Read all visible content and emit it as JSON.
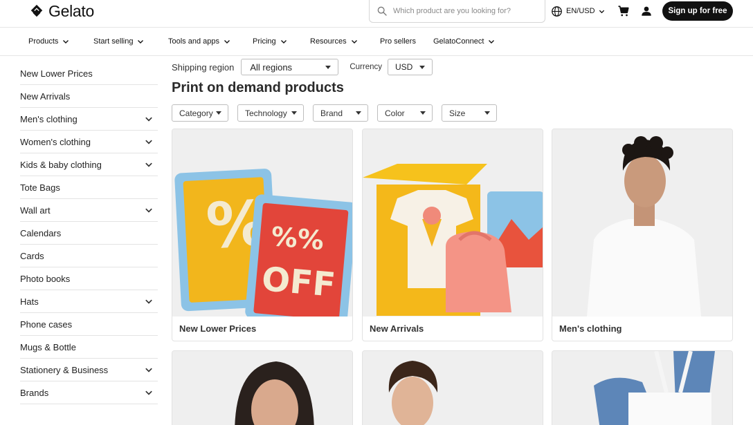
{
  "header": {
    "logo_text": "Gelato",
    "search_placeholder": "Which product are you looking for?",
    "lang_label": "EN/USD",
    "signup_label": "Sign up for free"
  },
  "nav": {
    "items": [
      {
        "label": "Products",
        "has_dropdown": true
      },
      {
        "label": "Start selling",
        "has_dropdown": true
      },
      {
        "label": "Tools and apps",
        "has_dropdown": true
      },
      {
        "label": "Pricing",
        "has_dropdown": true
      },
      {
        "label": "Resources",
        "has_dropdown": true
      },
      {
        "label": "Pro sellers",
        "has_dropdown": false
      },
      {
        "label": "GelatoConnect",
        "has_dropdown": true
      }
    ]
  },
  "sidebar": {
    "items": [
      {
        "label": "New Lower Prices",
        "expandable": false
      },
      {
        "label": "New Arrivals",
        "expandable": false
      },
      {
        "label": "Men's clothing",
        "expandable": true
      },
      {
        "label": "Women's clothing",
        "expandable": true
      },
      {
        "label": "Kids & baby clothing",
        "expandable": true
      },
      {
        "label": "Tote Bags",
        "expandable": false
      },
      {
        "label": "Wall art",
        "expandable": true
      },
      {
        "label": "Calendars",
        "expandable": false
      },
      {
        "label": "Cards",
        "expandable": false
      },
      {
        "label": "Photo books",
        "expandable": false
      },
      {
        "label": "Hats",
        "expandable": true
      },
      {
        "label": "Phone cases",
        "expandable": false
      },
      {
        "label": "Mugs & Bottle",
        "expandable": false
      },
      {
        "label": "Stationery & Business",
        "expandable": true
      },
      {
        "label": "Brands",
        "expandable": true
      }
    ]
  },
  "filters": {
    "shipping_label": "Shipping region",
    "shipping_value": "All regions",
    "currency_label": "Currency",
    "currency_value": "USD"
  },
  "page_title": "Print on demand products",
  "chips": [
    "Category",
    "Technology",
    "Brand",
    "Color",
    "Size"
  ],
  "cards": [
    {
      "caption": "New Lower Prices",
      "image": "sale-frames-image"
    },
    {
      "caption": "New Arrivals",
      "image": "box-apparel-image"
    },
    {
      "caption": "Men's clothing",
      "image": "man-tshirt-image"
    },
    {
      "caption": "",
      "image": "woman-portrait-image"
    },
    {
      "caption": "",
      "image": "kid-portrait-image"
    },
    {
      "caption": "",
      "image": "tote-bag-image"
    }
  ],
  "colors": {
    "brand_dark": "#111111",
    "border": "#e3e3e3",
    "card_bg": "#efefef"
  }
}
